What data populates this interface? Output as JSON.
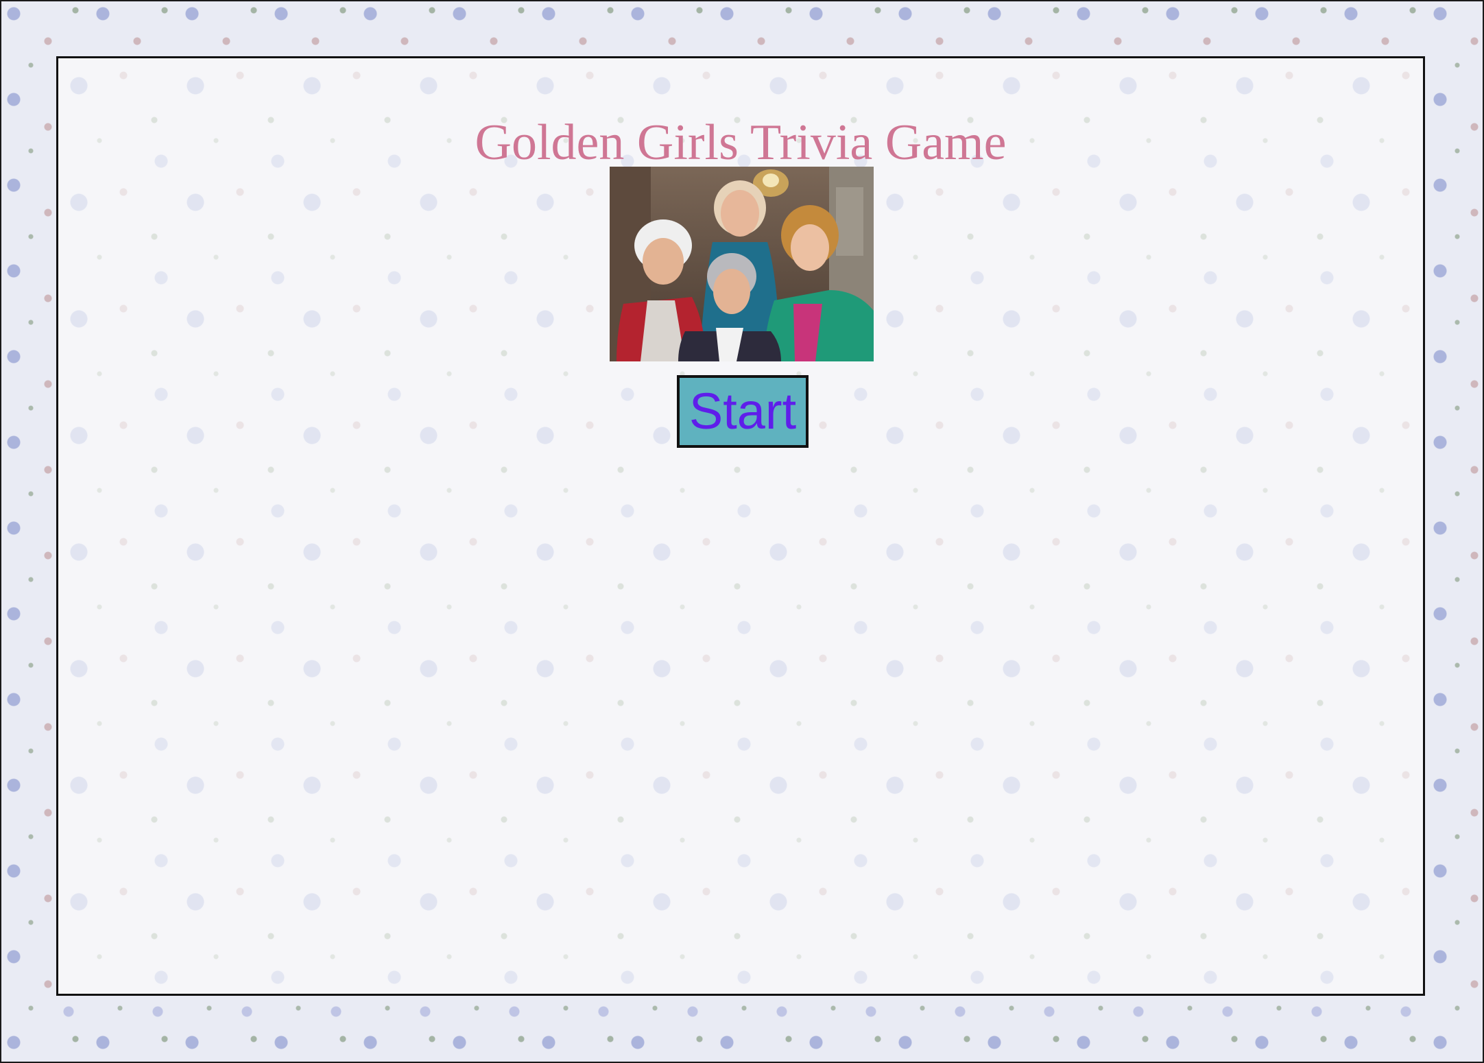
{
  "title": "Golden Girls Trivia Game",
  "start_button_label": "Start",
  "colors": {
    "title": "#cf7694",
    "button_background": "#5fb2bf",
    "button_text": "#5f1eea",
    "border": "#111111"
  },
  "image": {
    "semantic": "cast-photo"
  }
}
